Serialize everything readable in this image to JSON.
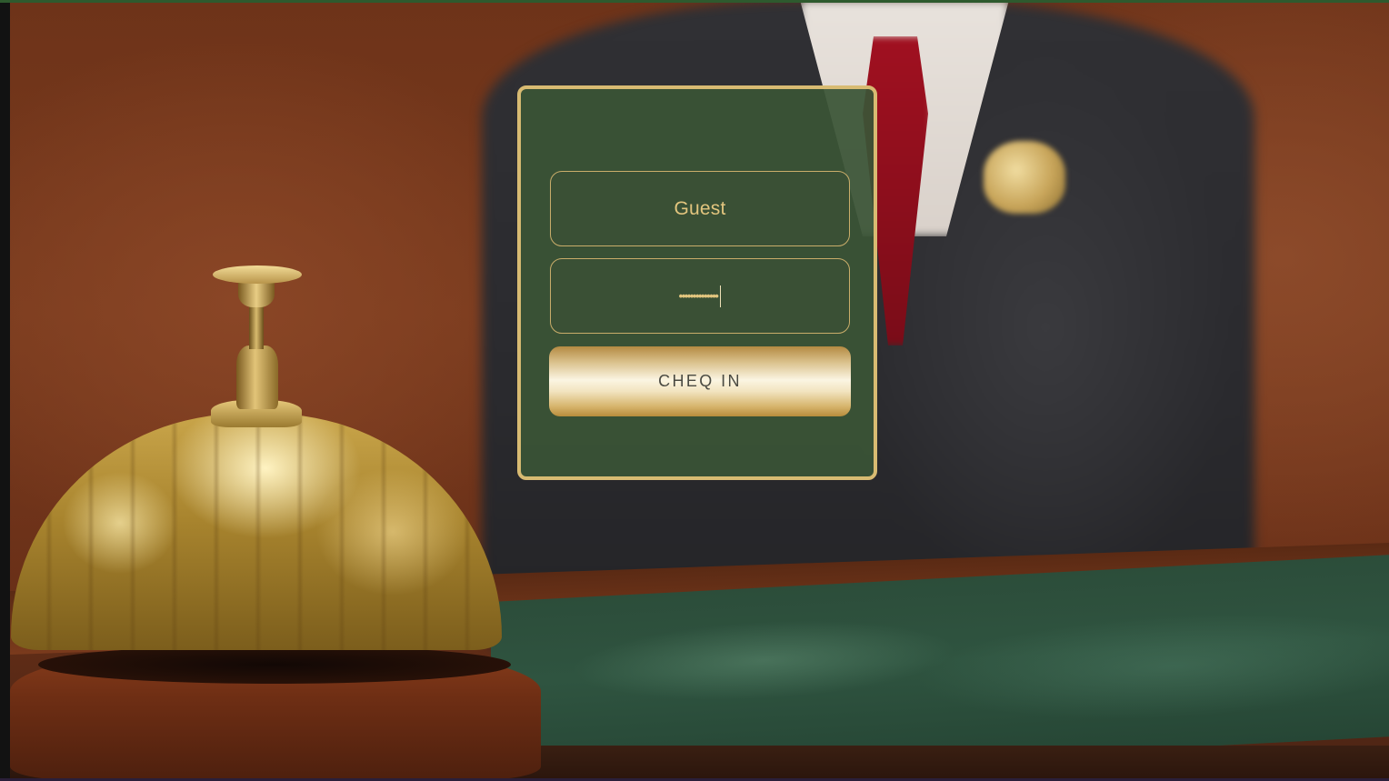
{
  "login": {
    "username_value": "Guest",
    "password_masked": "••••••••••••••",
    "submit_label": "CHEQ IN"
  },
  "background": {
    "scene": "hotel-reception-desk-with-service-bell"
  },
  "colors": {
    "card_background": "#3a5436",
    "card_border": "#d8bb72",
    "field_text": "#e2c57e",
    "button_text": "#4a4a42"
  }
}
